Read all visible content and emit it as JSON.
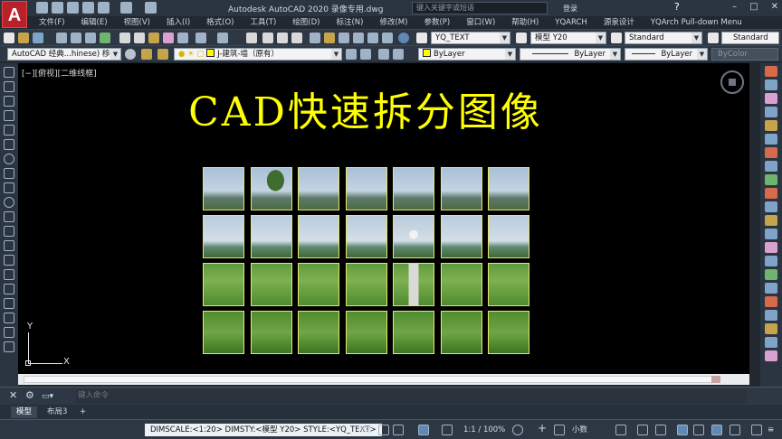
{
  "app": {
    "logo": "A",
    "title": "Autodesk AutoCAD 2020    录像专用.dwg",
    "search_placeholder": "键入关键字或短语",
    "login": "登录",
    "help": "?",
    "window_controls": [
      "–",
      "□",
      "✕"
    ]
  },
  "menu": {
    "items": [
      "文件(F)",
      "编辑(E)",
      "视图(V)",
      "插入(I)",
      "格式(O)",
      "工具(T)",
      "绘图(D)",
      "标注(N)",
      "修改(M)",
      "参数(P)",
      "窗口(W)",
      "帮助(H)",
      "YQARCH",
      "源泉设计",
      "YQArch Pull-down Menu"
    ]
  },
  "toolbar1": {
    "text_style": "YQ_TEXT",
    "dim_style": "模型 Y20",
    "table_style": "Standard",
    "multileader_style": "Standard"
  },
  "toolbar2": {
    "workspace": "AutoCAD 经典...hinese) 移植",
    "layer": "J-建筑-墙（原有）",
    "color": "ByLayer",
    "linetype": "ByLayer",
    "lineweight": "ByLayer",
    "plotstyle": "ByColor",
    "accent_color": "#ffff00"
  },
  "viewport": {
    "label": "[−][俯视][二维线框]",
    "headline": "CAD快速拆分图像",
    "headline_color": "#ffff00",
    "tile_grid": {
      "rows": 4,
      "cols": 7
    },
    "ucs": {
      "x": "X",
      "y": "Y"
    }
  },
  "command": {
    "placeholder": "键入命令"
  },
  "tabs": {
    "items": [
      "模型",
      "布局3",
      "+"
    ],
    "active": "模型"
  },
  "status": {
    "vars": "DIMSCALE:<1:20> DIMSTY:<模型 Y20> STYLE:<YQ_TEXT>",
    "space": "模型",
    "scale": "1:1 / 100%",
    "units": "小数"
  }
}
